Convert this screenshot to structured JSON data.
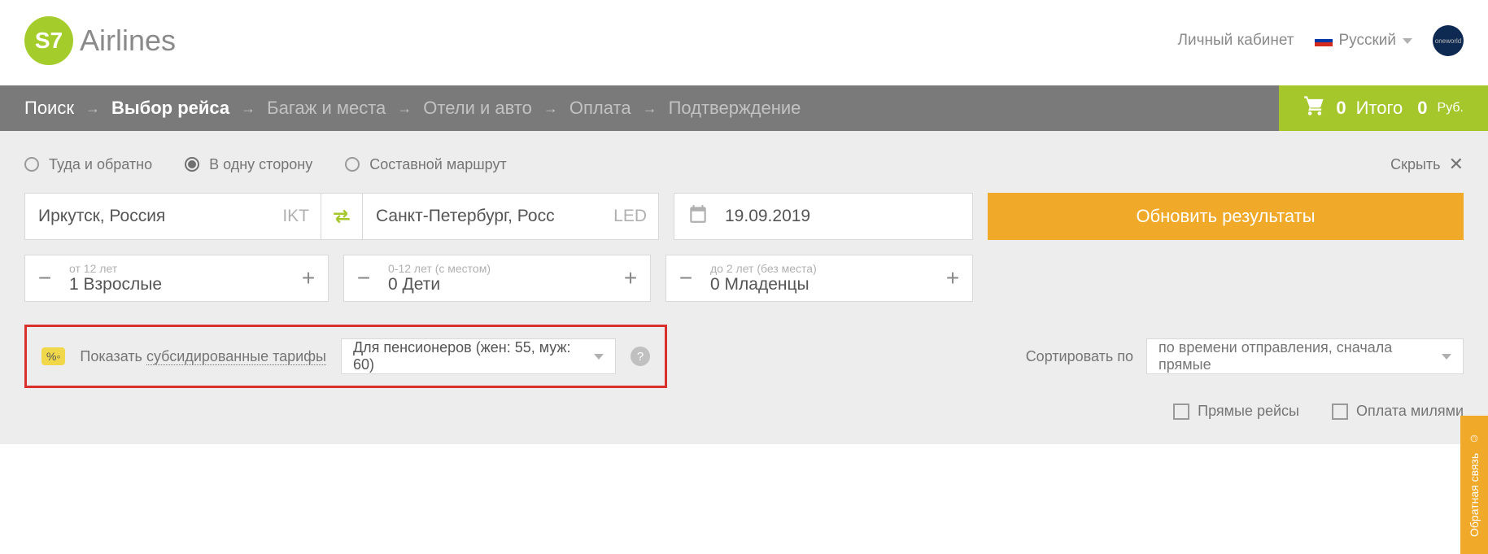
{
  "header": {
    "brand": "Airlines",
    "account": "Личный кабинет",
    "language": "Русский"
  },
  "breadcrumb": {
    "steps": [
      "Поиск",
      "Выбор рейса",
      "Багаж и места",
      "Отели и авто",
      "Оплата",
      "Подтверждение"
    ]
  },
  "cart": {
    "count": "0",
    "label": "Итого",
    "amount": "0",
    "currency": "Руб."
  },
  "trip_type": {
    "round": "Туда и обратно",
    "oneway": "В одну сторону",
    "multi": "Составной маршрут"
  },
  "hide": "Скрыть",
  "from": {
    "city": "Иркутск, Россия",
    "code": "IKT"
  },
  "to": {
    "city": "Санкт-Петербург, Росс",
    "code": "LED"
  },
  "date": "19.09.2019",
  "update_btn": "Обновить результаты",
  "pax": {
    "adults": {
      "hint": "от 12 лет",
      "value": "1 Взрослые"
    },
    "children": {
      "hint": "0-12 лет (с местом)",
      "value": "0 Дети"
    },
    "infants": {
      "hint": "до 2 лет (без места)",
      "value": "0 Младенцы"
    }
  },
  "subsidy": {
    "show_label_pre": "Показать ",
    "show_label_dotted": "субсидированные тарифы",
    "selected": "Для пенсионеров (жен: 55, муж: 60)"
  },
  "sort": {
    "label": "Сортировать по",
    "selected": "по времени отправления, сначала прямые"
  },
  "filters": {
    "direct": "Прямые рейсы",
    "miles": "Оплата милями"
  },
  "feedback": "Обратная связь"
}
